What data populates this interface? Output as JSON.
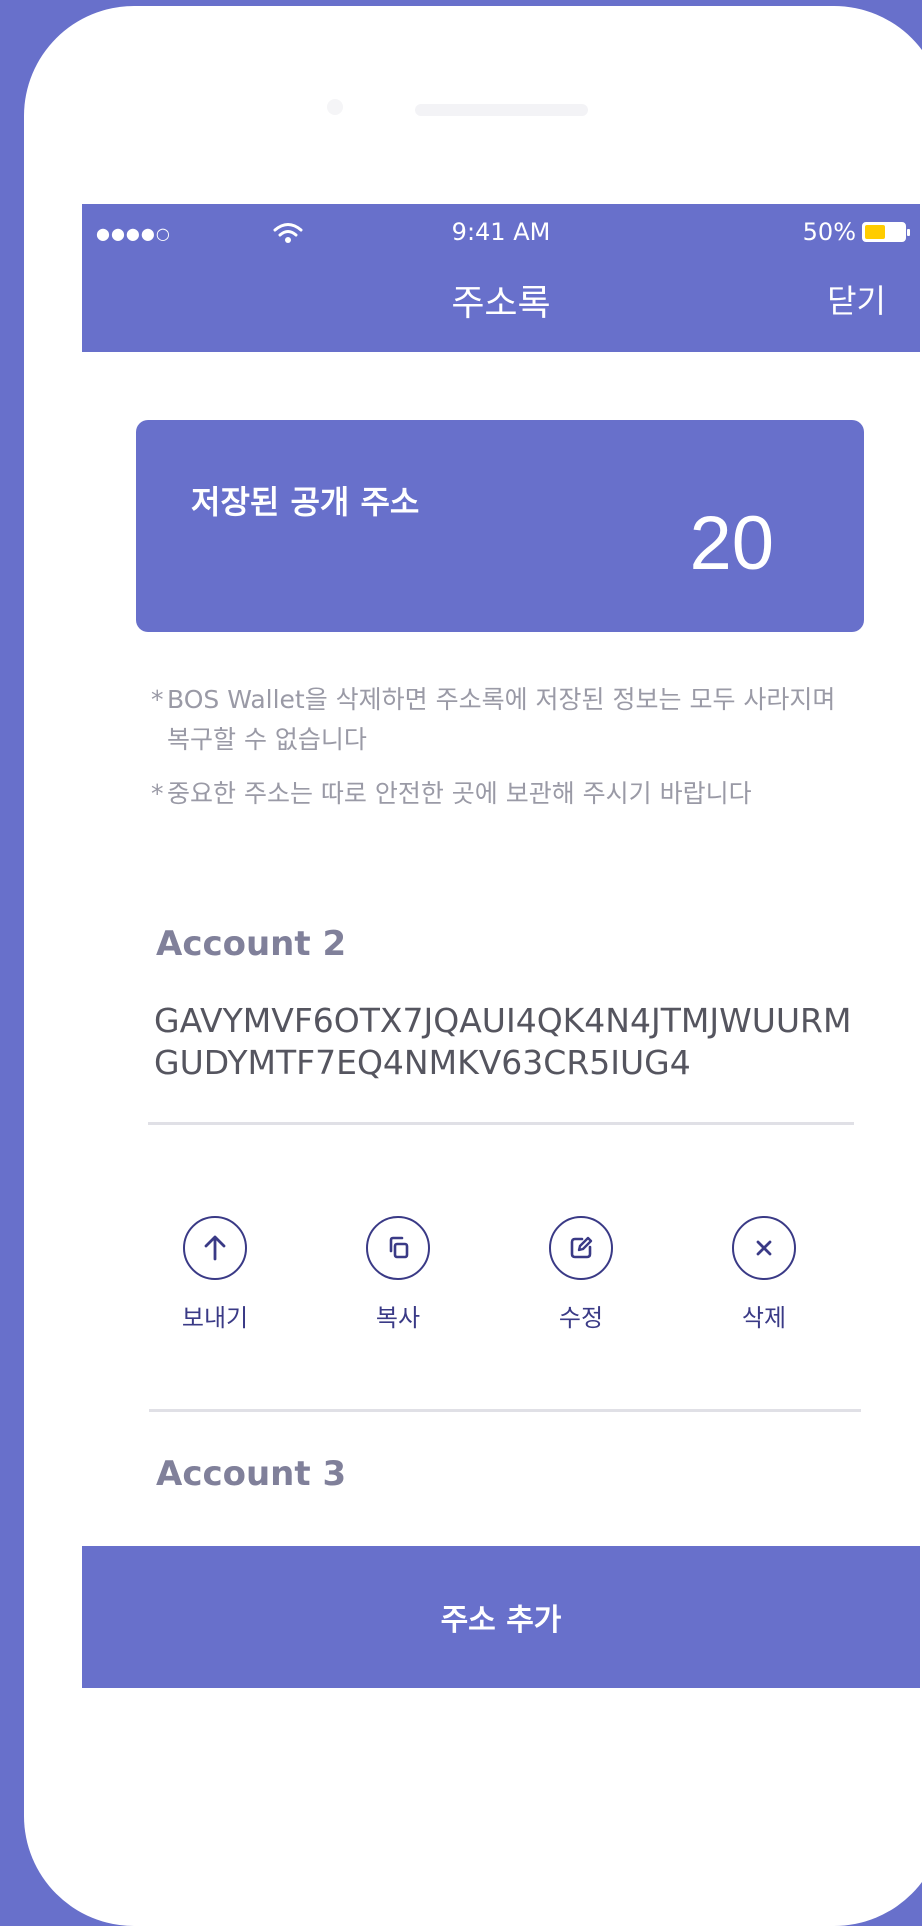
{
  "status_bar": {
    "signal": "●●●●○",
    "time": "9:41 AM",
    "battery": "50%",
    "battery_level": 0.5
  },
  "nav": {
    "title": "주소록",
    "close_label": "닫기"
  },
  "summary": {
    "label": "저장된 공개 주소",
    "count": "20"
  },
  "notices": [
    {
      "mark": "*",
      "text": "BOS Wallet을 삭제하면 주소록에 저장된 정보는 모두 사라지며 복구할 수 없습니다"
    },
    {
      "mark": "*",
      "text": "중요한 주소는 따로 안전한 곳에 보관해 주시기 바랍니다"
    }
  ],
  "accounts": [
    {
      "name": "Account 2",
      "address_line1": "GAVYMVF6OTX7JQAUI4QK4N4JTMJWUURM",
      "address_line2": "GUDYMTF7EQ4NMKV63CR5IUG4"
    },
    {
      "name": "Account 3"
    }
  ],
  "actions": [
    {
      "label": "보내기",
      "icon": "arrow-up-icon"
    },
    {
      "label": "복사",
      "icon": "copy-icon"
    },
    {
      "label": "수정",
      "icon": "edit-icon"
    },
    {
      "label": "삭제",
      "icon": "close-icon"
    }
  ],
  "bottom_button": {
    "label": "주소 추가"
  },
  "colors": {
    "brand": "#6870cb",
    "icon": "#3a3a86",
    "battery_fill": "#ffcc00"
  }
}
